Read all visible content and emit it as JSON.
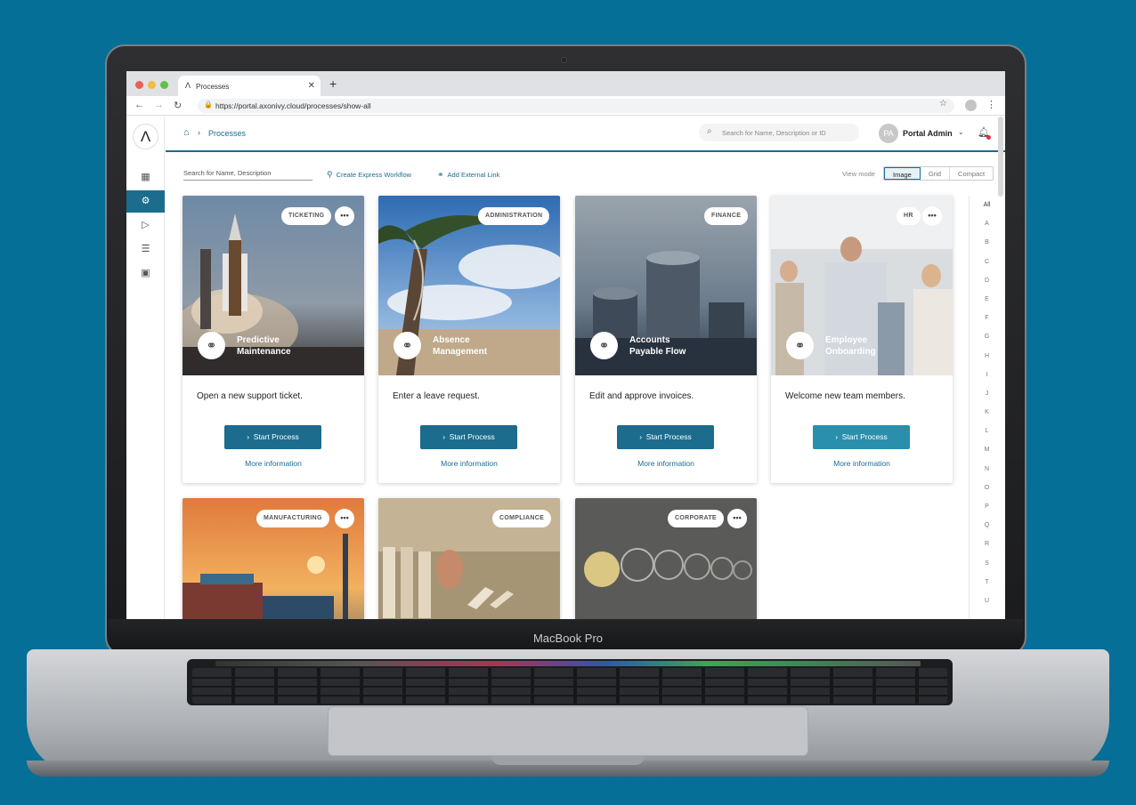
{
  "device": {
    "brand_label": "MacBook Pro"
  },
  "browser": {
    "tab_title": "Processes",
    "tab_logo": "Λ",
    "url": "https://portal.axonivy.cloud/processes/show-all"
  },
  "portal": {
    "logo": "Λ",
    "breadcrumb": "Processes",
    "top_search_placeholder": "Search for Name, Description or ID",
    "user_initials": "PA",
    "user_name": "Portal Admin"
  },
  "toolbar": {
    "search_placeholder": "Search for Name, Description",
    "create_express": "Create Express Workflow",
    "add_external": "Add External Link",
    "view_mode_label": "View mode",
    "view_modes": [
      "Image",
      "Grid",
      "Compact"
    ],
    "selected_view_mode": "Image"
  },
  "cards": [
    {
      "badge": "TICKETING",
      "has_menu": true,
      "title": "Predictive\nMaintenance",
      "description": "Open a new support ticket.",
      "button": "Start Process",
      "more": "More information"
    },
    {
      "badge": "ADMINISTRATION",
      "has_menu": false,
      "title": "Absence\nManagement",
      "description": "Enter a leave request.",
      "button": "Start Process",
      "more": "More information"
    },
    {
      "badge": "FINANCE",
      "has_menu": false,
      "title": "Accounts\nPayable Flow",
      "description": "Edit and approve invoices.",
      "button": "Start Process",
      "more": "More information"
    },
    {
      "badge": "HR",
      "has_menu": true,
      "title": "Employee\nOnboarding",
      "description": "Welcome new team members.",
      "button": "Start Process",
      "more": "More information"
    },
    {
      "badge": "MANUFACTURING",
      "has_menu": true
    },
    {
      "badge": "COMPLIANCE",
      "has_menu": false
    },
    {
      "badge": "CORPORATE",
      "has_menu": true
    }
  ],
  "alphabet": [
    "All",
    "A",
    "B",
    "C",
    "D",
    "E",
    "F",
    "G",
    "H",
    "I",
    "J",
    "K",
    "L",
    "M",
    "N",
    "O",
    "P",
    "Q",
    "R",
    "S",
    "T",
    "U"
  ],
  "icons": {
    "home": "home-icon",
    "search": "search-icon",
    "bell": "bell-icon",
    "link": "link-icon",
    "menu": "more-icon",
    "chevron": "chevron-right-icon"
  },
  "colors": {
    "primary": "#1b6c8d",
    "background": "#066f97"
  }
}
